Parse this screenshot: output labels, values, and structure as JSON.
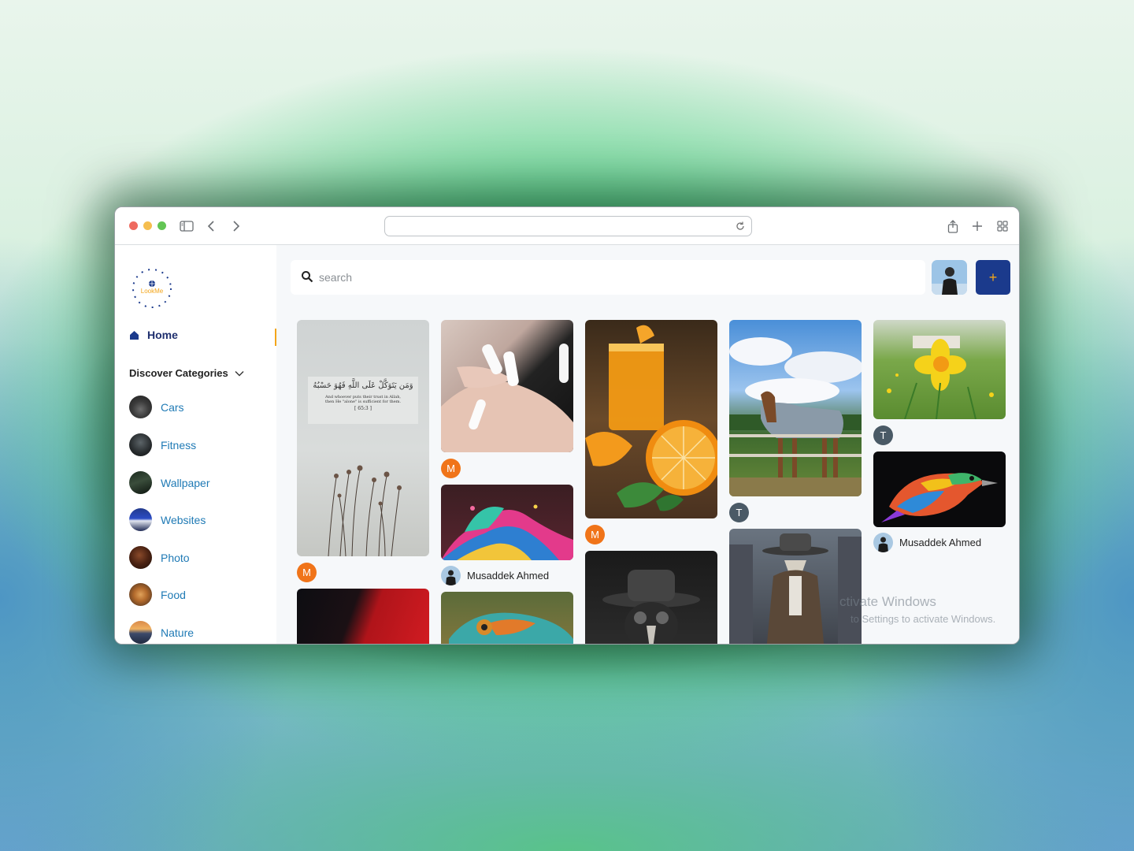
{
  "search": {
    "placeholder": "search"
  },
  "add_button": {
    "label": "+"
  },
  "sidebar": {
    "home_label": "Home",
    "discover_label": "Discover Categories",
    "categories": [
      {
        "label": "Cars"
      },
      {
        "label": "Fitness"
      },
      {
        "label": "Wallpaper"
      },
      {
        "label": "Websites"
      },
      {
        "label": "Photo"
      },
      {
        "label": "Food"
      },
      {
        "label": "Nature"
      }
    ]
  },
  "logo": {
    "brand": "LookMe",
    "ring_text": "L o o k M e"
  },
  "feed": {
    "pins": [
      {
        "subject": "quote-wallpaper",
        "author_initial": "M"
      },
      {
        "subject": "nails",
        "author_initial": "M"
      },
      {
        "subject": "orange-juice",
        "author_initial": "M"
      },
      {
        "subject": "horse",
        "author_initial": "T"
      },
      {
        "subject": "daffodil",
        "author_initial": "T"
      },
      {
        "subject": "colorful-wave",
        "author_name": "Musaddek Ahmed"
      },
      {
        "subject": "rainbow-bird",
        "author_name": "Musaddek Ahmed"
      },
      {
        "subject": "red-black-abstract"
      },
      {
        "subject": "chameleon"
      },
      {
        "subject": "plague-doctor-portrait"
      },
      {
        "subject": "plague-doctor-city"
      }
    ],
    "quote_arabic": "وَمَن يَتَوَكَّلْ عَلَى اللَّهِ فَهُوَ حَسْبُهُ",
    "quote_english_1": "And whoever puts their trust in Allah,",
    "quote_english_2": "then He \"alone\" is sufficient for them.",
    "quote_ref": "[ 65:3 ]"
  },
  "watermark": {
    "line1": "ctivate Windows",
    "line2": "to Settings to activate Windows."
  },
  "colors": {
    "accent": "#1b3a8c",
    "highlight": "#f3a51a",
    "link": "#1f7ab5",
    "avatar_orange": "#f07419",
    "avatar_slate": "#4a5a66"
  }
}
